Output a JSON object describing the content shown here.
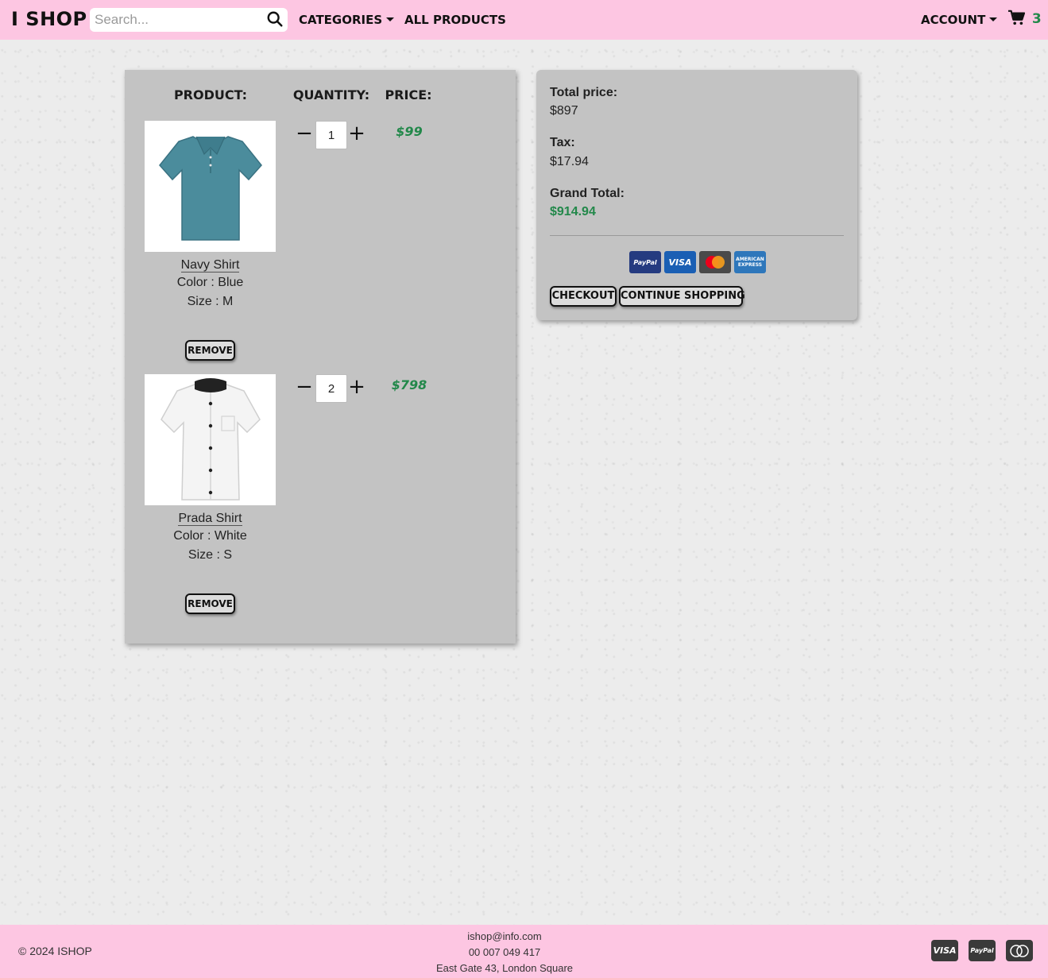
{
  "brand": "I SHOP",
  "nav": {
    "search_placeholder": "Search...",
    "categories": "CATEGORIES",
    "all_products": "ALL PRODUCTS",
    "account": "ACCOUNT",
    "cart_count": "3"
  },
  "cart": {
    "headers": {
      "product": "PRODUCT:",
      "quantity": "QUANTITY:",
      "price": "PRICE:"
    },
    "items": [
      {
        "name": "Navy Shirt",
        "color": "Color : Blue",
        "size": "Size : M",
        "quantity": "1",
        "price": "$99",
        "remove": "REMOVE",
        "shirt_color": "#4b8c9c"
      },
      {
        "name": "Prada Shirt",
        "color": "Color : White",
        "size": "Size : S",
        "quantity": "2",
        "price": "$798",
        "remove": "REMOVE",
        "shirt_color": "#f4f4f4"
      }
    ]
  },
  "summary": {
    "total_label": "Total price:",
    "total_value": "$897",
    "tax_label": "Tax:",
    "tax_value": "$17.94",
    "grand_label": "Grand Total:",
    "grand_value": "$914.94",
    "pay_icons": [
      "PayPal",
      "VISA",
      "mastercard",
      "AMERICAN EXPRESS"
    ],
    "checkout": "CHECKOUT",
    "continue": "CONTINUE SHOPPING"
  },
  "footer": {
    "copyright": "© 2024 ISHOP",
    "email": "ishop@info.com",
    "phone": "00 007 049 417",
    "address": "East Gate 43, London Square",
    "pay_icons": [
      "VISA",
      "PayPal",
      "mastercard"
    ]
  },
  "colors": {
    "navbar": "#fdc6e2",
    "panel": "#c3c3c3",
    "accent_green": "#22884a"
  }
}
